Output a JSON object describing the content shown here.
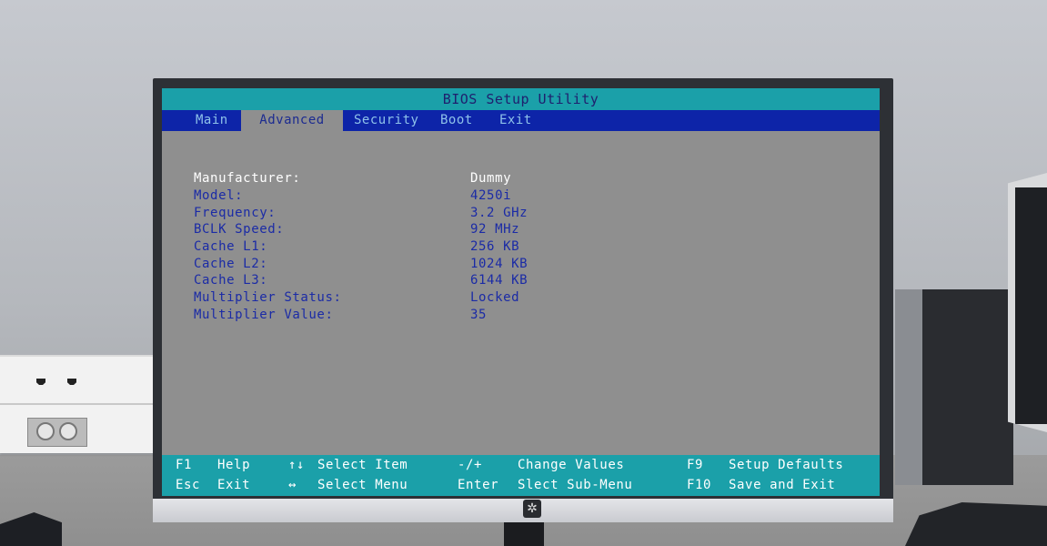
{
  "bios": {
    "title": "BIOS Setup Utility",
    "tabs": [
      {
        "label": "Main"
      },
      {
        "label": "Advanced"
      },
      {
        "label": "Security"
      },
      {
        "label": "Boot"
      },
      {
        "label": "Exit"
      }
    ],
    "active_tab": "Advanced",
    "cpu_info": [
      {
        "label": "Manufacturer:",
        "value": "Dummy"
      },
      {
        "label": "Model:",
        "value": "4250i"
      },
      {
        "label": "Frequency:",
        "value": "3.2 GHz"
      },
      {
        "label": "BCLK Speed:",
        "value": "92 MHz"
      },
      {
        "label": "Cache L1:",
        "value": "256 KB"
      },
      {
        "label": "Cache L2:",
        "value": "1024 KB"
      },
      {
        "label": "Cache L3:",
        "value": "6144 KB"
      },
      {
        "label": "Multiplier Status:",
        "value": "Locked"
      },
      {
        "label": "Multiplier Value:",
        "value": "35"
      }
    ],
    "footer": {
      "row1": [
        {
          "key": "F1",
          "desc": "Help"
        },
        {
          "key": "↑↓",
          "desc": "Select Item"
        },
        {
          "key": "-/+",
          "desc": "Change Values"
        },
        {
          "key": "F9",
          "desc": "Setup Defaults"
        }
      ],
      "row2": [
        {
          "key": "Esc",
          "desc": "Exit"
        },
        {
          "key": "↔",
          "desc": "Select Menu"
        },
        {
          "key": "Enter",
          "desc": "Slect Sub-Menu"
        },
        {
          "key": "F10",
          "desc": "Save and Exit"
        }
      ]
    },
    "colors": {
      "title_bg": "#1ba0a9",
      "menu_bg": "#0d24a8",
      "screen_bg": "#8f8f8f",
      "text_blue": "#1b2ba6"
    }
  },
  "monitor": {
    "power_icon": "power-button-icon"
  }
}
